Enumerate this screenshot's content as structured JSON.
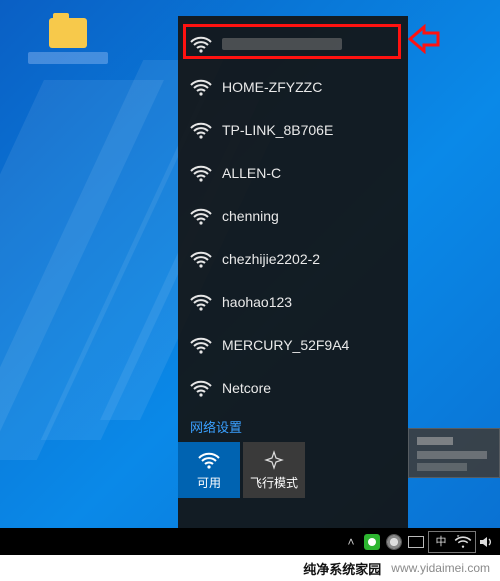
{
  "desktop": {
    "icon_label": " "
  },
  "flyout": {
    "networks": [
      {
        "ssid": " ",
        "redacted": true
      },
      {
        "ssid": "HOME-ZFYZZC"
      },
      {
        "ssid": "TP-LINK_8B706E"
      },
      {
        "ssid": "ALLEN-C"
      },
      {
        "ssid": "chenning"
      },
      {
        "ssid": "chezhijie2202-2"
      },
      {
        "ssid": "haohao123"
      },
      {
        "ssid": "MERCURY_52F9A4"
      },
      {
        "ssid": "Netcore"
      }
    ],
    "settings_label": "网络设置",
    "tiles": {
      "wifi": "可用",
      "airplane": "飞行模式"
    }
  },
  "watermark": {
    "brand": "纯净系统家园",
    "url": "www.yidaimei.com"
  }
}
